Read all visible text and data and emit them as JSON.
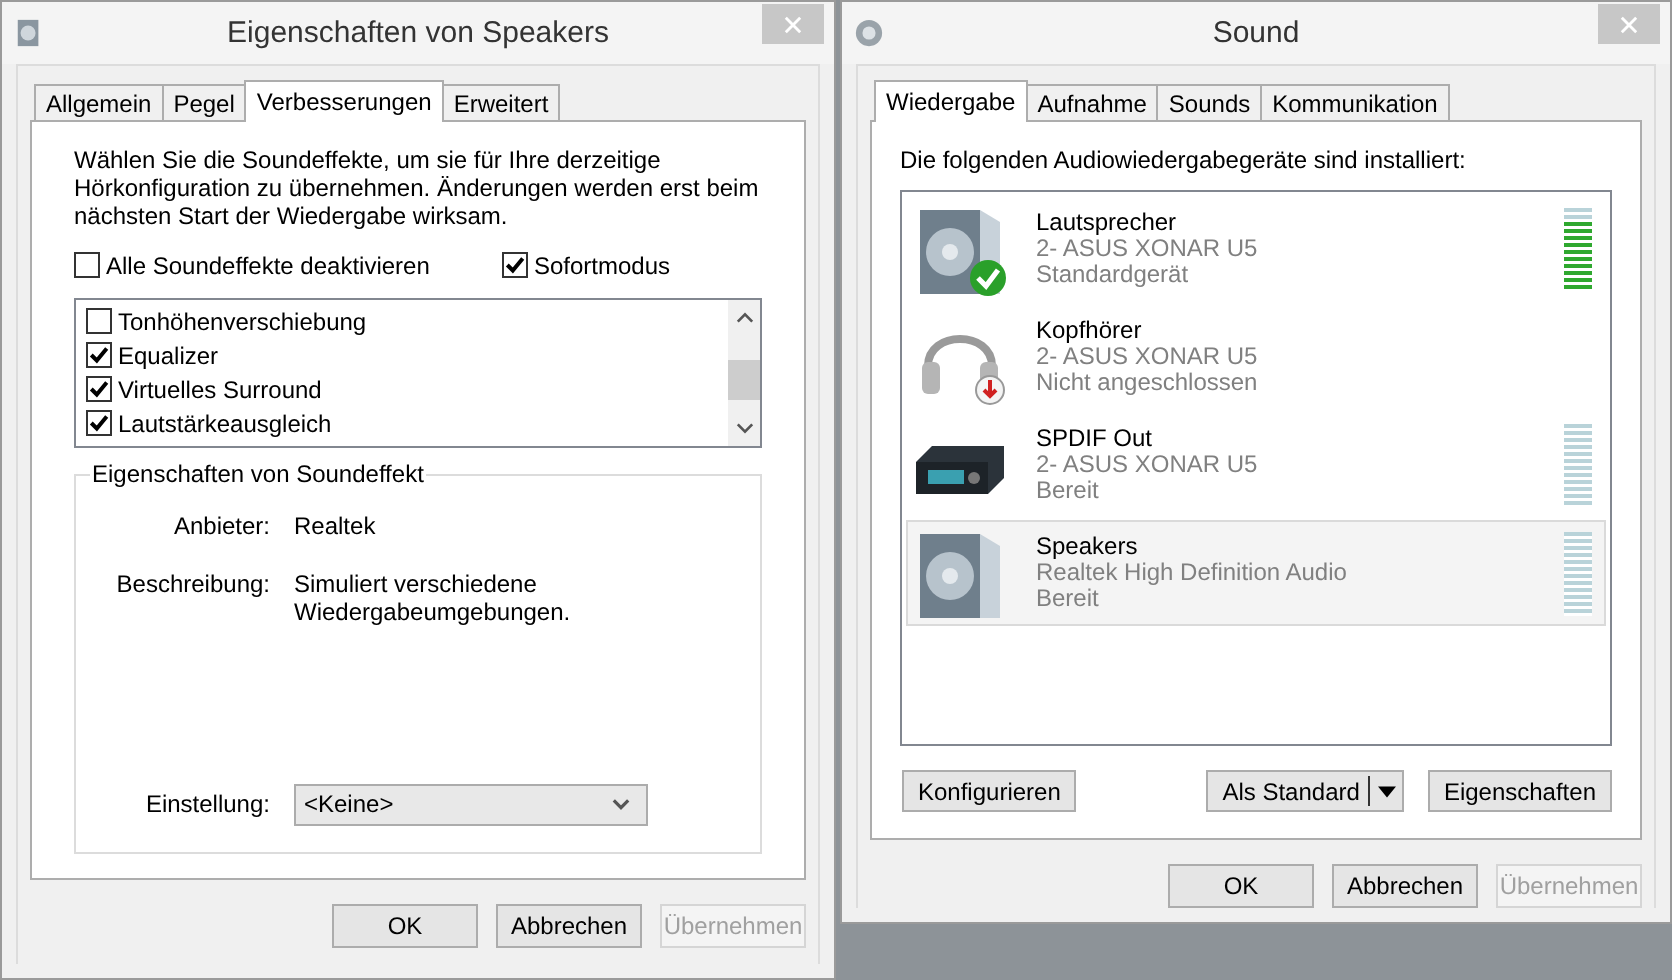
{
  "effects_dialog": {
    "title": "Eigenschaften von Speakers",
    "tabs": [
      {
        "label": "Allgemein",
        "selected": false
      },
      {
        "label": "Pegel",
        "selected": false
      },
      {
        "label": "Verbesserungen",
        "selected": true
      },
      {
        "label": "Erweitert",
        "selected": false
      }
    ],
    "description": "Wählen Sie die Soundeffekte, um sie für Ihre derzeitige Hörkonfiguration zu übernehmen. Änderungen werden erst beim nächsten Start der Wiedergabe wirksam.",
    "disable_all": {
      "label": "Alle Soundeffekte deaktivieren",
      "checked": false
    },
    "immediate_mode": {
      "label": "Sofortmodus",
      "checked": true
    },
    "effects": [
      {
        "label": "Tonhöhenverschiebung",
        "checked": false
      },
      {
        "label": "Equalizer",
        "checked": true
      },
      {
        "label": "Virtuelles Surround",
        "checked": true
      },
      {
        "label": "Lautstärkeausgleich",
        "checked": true
      }
    ],
    "properties": {
      "title": "Eigenschaften von Soundeffekt",
      "fields": [
        {
          "label": "Anbieter:",
          "value": "Realtek"
        },
        {
          "label": "Beschreibung:",
          "value": "Simuliert verschiedene Wiedergabeumgebungen."
        }
      ],
      "setting": {
        "label": "Einstellung:",
        "value": "<Keine>"
      }
    },
    "buttons": [
      {
        "label": "OK",
        "disabled": false
      },
      {
        "label": "Abbrechen",
        "disabled": false
      },
      {
        "label": "Übernehmen",
        "disabled": true
      }
    ]
  },
  "sound_dialog": {
    "title": "Sound",
    "tabs": [
      {
        "label": "Wiedergabe",
        "selected": true
      },
      {
        "label": "Aufnahme",
        "selected": false
      },
      {
        "label": "Sounds",
        "selected": false
      },
      {
        "label": "Kommunikation",
        "selected": false
      }
    ],
    "intro": "Die folgenden Audiowiedergabegeräte sind installiert:",
    "devices": [
      {
        "name": "Lautsprecher",
        "driver": "2- ASUS XONAR U5",
        "status": "Standardgerät",
        "kind": "speaker",
        "is_default": true,
        "unplugged": false,
        "level": 0.83,
        "selected": false
      },
      {
        "name": "Kopfhörer",
        "driver": "2- ASUS XONAR U5",
        "status": "Nicht angeschlossen",
        "kind": "headphones",
        "is_default": false,
        "unplugged": true,
        "selected": false
      },
      {
        "name": "SPDIF Out",
        "driver": "2- ASUS XONAR U5",
        "status": "Bereit",
        "kind": "receiver",
        "is_default": false,
        "unplugged": false,
        "selected": false
      },
      {
        "name": "Speakers",
        "driver": "Realtek High Definition Audio",
        "status": "Bereit",
        "kind": "speaker",
        "is_default": false,
        "unplugged": false,
        "selected": true
      }
    ],
    "actions": [
      {
        "label": "Konfigurieren",
        "kind": "button"
      },
      {
        "label": "Als Standard",
        "kind": "split"
      },
      {
        "label": "Eigenschaften",
        "kind": "button"
      }
    ],
    "buttons": [
      {
        "label": "OK",
        "disabled": false
      },
      {
        "label": "Abbrechen",
        "disabled": false
      },
      {
        "label": "Übernehmen",
        "disabled": true
      }
    ]
  }
}
